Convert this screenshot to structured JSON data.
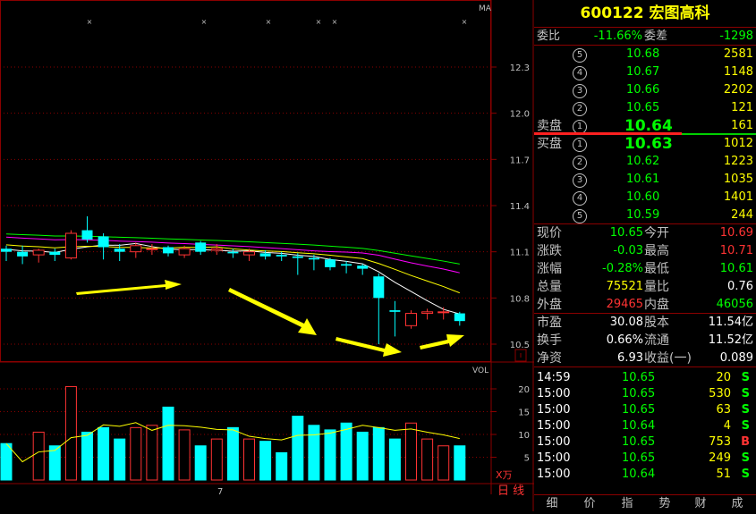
{
  "stock": {
    "code": "600122",
    "name": "宏图高科"
  },
  "chart": {
    "ma_label": "MA",
    "vol_label": "VOL",
    "vol_unit": "X万",
    "period_label": "日 线",
    "date_label": "7",
    "price_ticks": [
      "12.3",
      "12.0",
      "11.7",
      "11.4",
      "11.1",
      "10.8",
      "10.5"
    ],
    "vol_ticks": [
      "20",
      "15",
      "10",
      "5"
    ]
  },
  "chart_data": {
    "type": "candlestick",
    "price_axis": {
      "ticks": [
        12.3,
        12.0,
        11.7,
        11.4,
        11.1,
        10.8,
        10.5
      ]
    },
    "candles": [
      {
        "o": 11.12,
        "h": 11.14,
        "l": 11.04,
        "c": 11.1
      },
      {
        "o": 11.1,
        "h": 11.14,
        "l": 11.02,
        "c": 11.07
      },
      {
        "o": 11.08,
        "h": 11.12,
        "l": 11.03,
        "c": 11.11
      },
      {
        "o": 11.1,
        "h": 11.12,
        "l": 11.04,
        "c": 11.08
      },
      {
        "o": 11.06,
        "h": 11.24,
        "l": 11.05,
        "c": 11.22
      },
      {
        "o": 11.24,
        "h": 11.33,
        "l": 11.16,
        "c": 11.18
      },
      {
        "o": 11.2,
        "h": 11.22,
        "l": 11.05,
        "c": 11.13
      },
      {
        "o": 11.12,
        "h": 11.15,
        "l": 11.04,
        "c": 11.1
      },
      {
        "o": 11.1,
        "h": 11.16,
        "l": 11.06,
        "c": 11.14
      },
      {
        "o": 11.12,
        "h": 11.15,
        "l": 11.08,
        "c": 11.12
      },
      {
        "o": 11.13,
        "h": 11.14,
        "l": 11.07,
        "c": 11.09
      },
      {
        "o": 11.08,
        "h": 11.14,
        "l": 11.06,
        "c": 11.12
      },
      {
        "o": 11.16,
        "h": 11.17,
        "l": 11.08,
        "c": 11.1
      },
      {
        "o": 11.11,
        "h": 11.15,
        "l": 11.08,
        "c": 11.12
      },
      {
        "o": 11.1,
        "h": 11.12,
        "l": 11.06,
        "c": 11.09
      },
      {
        "o": 11.08,
        "h": 11.12,
        "l": 11.04,
        "c": 11.1
      },
      {
        "o": 11.09,
        "h": 11.11,
        "l": 11.05,
        "c": 11.07
      },
      {
        "o": 11.08,
        "h": 11.1,
        "l": 11.04,
        "c": 11.07
      },
      {
        "o": 11.07,
        "h": 11.09,
        "l": 10.95,
        "c": 11.06
      },
      {
        "o": 11.06,
        "h": 11.08,
        "l": 10.98,
        "c": 11.05
      },
      {
        "o": 11.05,
        "h": 11.06,
        "l": 10.98,
        "c": 11.0
      },
      {
        "o": 11.02,
        "h": 11.04,
        "l": 10.96,
        "c": 11.01
      },
      {
        "o": 11.01,
        "h": 11.02,
        "l": 10.95,
        "c": 10.99
      },
      {
        "o": 10.94,
        "h": 10.96,
        "l": 10.5,
        "c": 10.8
      },
      {
        "o": 10.72,
        "h": 10.78,
        "l": 10.55,
        "c": 10.71
      },
      {
        "o": 10.62,
        "h": 10.72,
        "l": 10.6,
        "c": 10.7
      },
      {
        "o": 10.7,
        "h": 10.73,
        "l": 10.66,
        "c": 10.71
      },
      {
        "o": 10.71,
        "h": 10.74,
        "l": 10.66,
        "c": 10.71
      },
      {
        "o": 10.7,
        "h": 10.71,
        "l": 10.62,
        "c": 10.65
      }
    ],
    "volumes": [
      8,
      0,
      10.5,
      7.5,
      20.5,
      10.5,
      11.5,
      9,
      11.5,
      12,
      16,
      11,
      7.5,
      9,
      11.5,
      9,
      8.5,
      6,
      14,
      12,
      11,
      12.5,
      10.5,
      11.5,
      9,
      12.5,
      9,
      7.5,
      7.5
    ],
    "vol_axis": {
      "ticks": [
        20,
        15,
        10,
        5
      ]
    }
  },
  "quote": {
    "weibi_label": "委比",
    "weibi": "-11.66%",
    "weicha_label": "委差",
    "weicha": "-1298",
    "sell_label": "卖盘",
    "buy_label": "买盘",
    "asks": [
      {
        "n": "⑤",
        "p": "10.68",
        "v": "2581"
      },
      {
        "n": "④",
        "p": "10.67",
        "v": "1148"
      },
      {
        "n": "③",
        "p": "10.66",
        "v": "2202"
      },
      {
        "n": "②",
        "p": "10.65",
        "v": "121"
      },
      {
        "n": "①",
        "p": "10.64",
        "v": "161"
      }
    ],
    "bids": [
      {
        "n": "①",
        "p": "10.63",
        "v": "1012"
      },
      {
        "n": "②",
        "p": "10.62",
        "v": "1223"
      },
      {
        "n": "③",
        "p": "10.61",
        "v": "1035"
      },
      {
        "n": "④",
        "p": "10.60",
        "v": "1401"
      },
      {
        "n": "⑤",
        "p": "10.59",
        "v": "244"
      }
    ]
  },
  "stats": [
    {
      "l1": "现价",
      "v1": "10.65",
      "c1": "grn",
      "l2": "今开",
      "v2": "10.69",
      "c2": "red"
    },
    {
      "l1": "涨跌",
      "v1": "-0.03",
      "c1": "grn",
      "l2": "最高",
      "v2": "10.71",
      "c2": "red"
    },
    {
      "l1": "涨幅",
      "v1": "-0.28%",
      "c1": "grn",
      "l2": "最低",
      "v2": "10.61",
      "c2": "grn"
    },
    {
      "l1": "总量",
      "v1": "75521",
      "c1": "yel",
      "l2": "量比",
      "v2": "0.76",
      "c2": "wht"
    },
    {
      "l1": "外盘",
      "v1": "29465",
      "c1": "red",
      "l2": "内盘",
      "v2": "46056",
      "c2": "grn"
    },
    {
      "l1": "市盈",
      "v1": "30.08",
      "c1": "wht",
      "l2": "股本",
      "v2": "11.54亿",
      "c2": "wht"
    },
    {
      "l1": "换手",
      "v1": "0.66%",
      "c1": "wht",
      "l2": "流通",
      "v2": "11.52亿",
      "c2": "wht"
    },
    {
      "l1": "净资",
      "v1": "6.93",
      "c1": "wht",
      "l2": "收益(一)",
      "v2": "0.089",
      "c2": "wht"
    }
  ],
  "trades": [
    {
      "t": "14:59",
      "p": "10.65",
      "v": "20",
      "s": "S"
    },
    {
      "t": "15:00",
      "p": "10.65",
      "v": "530",
      "s": "S"
    },
    {
      "t": "15:00",
      "p": "10.65",
      "v": "63",
      "s": "S"
    },
    {
      "t": "15:00",
      "p": "10.64",
      "v": "4",
      "s": "S"
    },
    {
      "t": "15:00",
      "p": "10.65",
      "v": "753",
      "s": "B"
    },
    {
      "t": "15:00",
      "p": "10.65",
      "v": "249",
      "s": "S"
    },
    {
      "t": "15:00",
      "p": "10.64",
      "v": "51",
      "s": "S"
    }
  ],
  "tabs": [
    "细",
    "价",
    "指",
    "势",
    "财",
    "成"
  ]
}
